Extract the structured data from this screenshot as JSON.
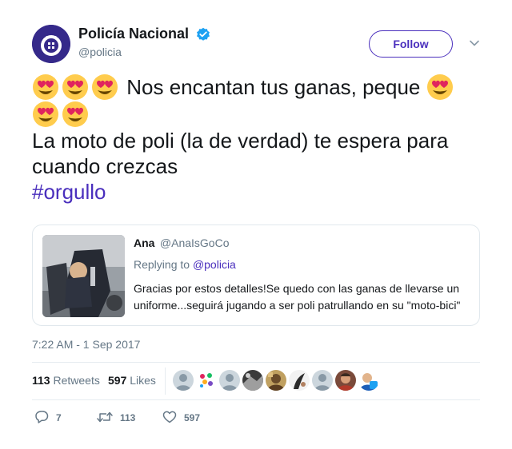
{
  "author": {
    "display_name": "Policía Nacional",
    "handle": "@policia",
    "verified": true,
    "follow_label": "Follow"
  },
  "tweet": {
    "line1_text": "Nos encantan tus ganas, peque",
    "line2_text": "La moto de poli (la de verdad) te espera para",
    "line3_text": "cuando crezcas",
    "hashtag": "#orgullo",
    "emoji": "heart-eyes-emoji"
  },
  "quoted": {
    "name": "Ana",
    "handle": "@AnaIsGoCo",
    "replying_prefix": "Replying to",
    "replying_to": "@policia",
    "text": "Gracias por estos detalles!Se quedo con las ganas de llevarse un uniforme...seguirá jugando a ser poli patrullando en su \"moto-bici\""
  },
  "timestamp": "7:22 AM - 1 Sep 2017",
  "stats": {
    "retweets_count": "113",
    "retweets_label": "Retweets",
    "likes_count": "597",
    "likes_label": "Likes"
  },
  "actions": {
    "reply_count": "7",
    "retweet_count": "113",
    "like_count": "597"
  },
  "colors": {
    "accent": "#4a2fbd",
    "verified": "#1da1f2",
    "muted": "#657786",
    "text": "#14171a"
  }
}
